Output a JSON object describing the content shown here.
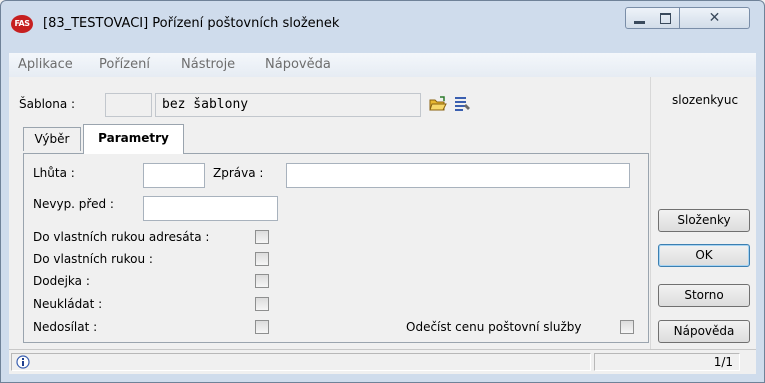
{
  "window": {
    "title": "[83_TESTOVACI] Pořízení poštovních složenek",
    "logo_text": "FAS"
  },
  "menu": [
    "Aplikace",
    "Pořízení",
    "Nástroje",
    "Nápověda"
  ],
  "sablona": {
    "label": "Šablona :",
    "code_value": "",
    "name_value": "bez šablony"
  },
  "right_panel": {
    "form_id": "slozenkyuc",
    "buttons": [
      "Složenky",
      "OK",
      "Storno",
      "Nápověda"
    ]
  },
  "tabs": [
    "Výběr",
    "Parametry"
  ],
  "active_tab": "Parametry",
  "fields": {
    "lhuta_label": "Lhůta :",
    "lhuta_value": "",
    "zprava_label": "Zpráva :",
    "zprava_value": "",
    "nevyp_label": "Nevyp. před :",
    "nevyp_value": ""
  },
  "checkboxes": [
    {
      "label": "Do vlastních rukou adresáta :",
      "checked": false
    },
    {
      "label": "Do vlastních rukou :",
      "checked": false
    },
    {
      "label": "Dodejka :",
      "checked": false
    },
    {
      "label": "Neukládat :",
      "checked": false
    },
    {
      "label": "Nedosílat :",
      "checked": false
    }
  ],
  "odecist": {
    "label": "Odečíst cenu poštovní služby",
    "checked": false
  },
  "status": {
    "page": "1/1"
  },
  "icons": [
    "app-logo",
    "minimize-icon",
    "maximize-icon",
    "close-icon",
    "open-folder-icon",
    "list-icon",
    "info-icon"
  ]
}
